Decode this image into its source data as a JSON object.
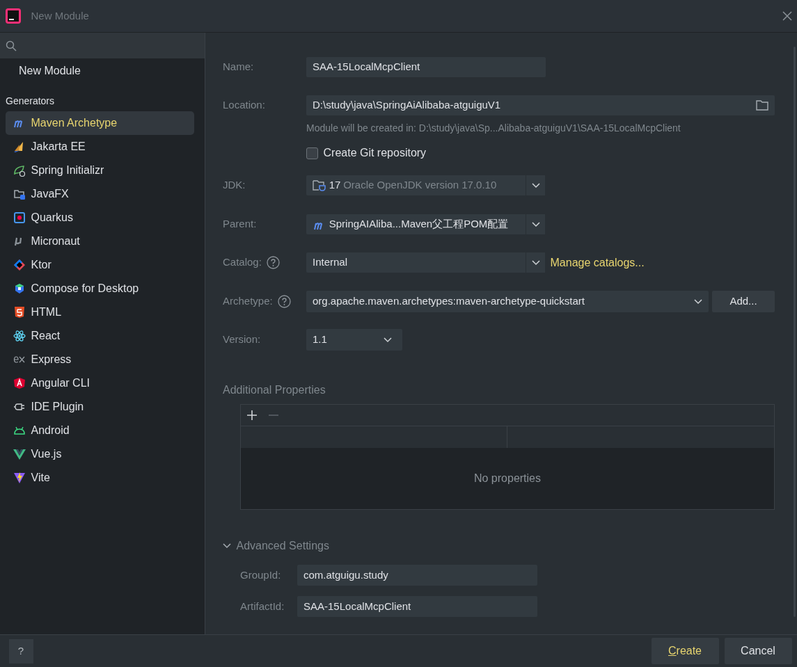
{
  "window": {
    "title": "New Module"
  },
  "sidebar": {
    "top_item": {
      "label": "New Module",
      "selected": false
    },
    "section": "Generators",
    "items": [
      {
        "label": "Maven Archetype",
        "selected": true
      },
      {
        "label": "Jakarta EE",
        "selected": false
      },
      {
        "label": "Spring Initializr",
        "selected": false
      },
      {
        "label": "JavaFX",
        "selected": false
      },
      {
        "label": "Quarkus",
        "selected": false
      },
      {
        "label": "Micronaut",
        "selected": false
      },
      {
        "label": "Ktor",
        "selected": false
      },
      {
        "label": "Compose for Desktop",
        "selected": false
      },
      {
        "label": "HTML",
        "selected": false
      },
      {
        "label": "React",
        "selected": false
      },
      {
        "label": "Express",
        "selected": false
      },
      {
        "label": "Angular CLI",
        "selected": false
      },
      {
        "label": "IDE Plugin",
        "selected": false
      },
      {
        "label": "Android",
        "selected": false
      },
      {
        "label": "Vue.js",
        "selected": false
      },
      {
        "label": "Vite",
        "selected": false
      }
    ]
  },
  "form": {
    "name": {
      "label": "Name:",
      "value": "SAA-15LocalMcpClient"
    },
    "location": {
      "label": "Location:",
      "value": "D:\\study\\java\\SpringAiAlibaba-atguiguV1",
      "note": "Module will be created in: D:\\study\\java\\Sp...Alibaba-atguiguV1\\SAA-15LocalMcpClient"
    },
    "git": {
      "label": "Create Git repository",
      "checked": false
    },
    "jdk": {
      "label": "JDK:",
      "version": "17",
      "text": "Oracle OpenJDK version 17.0.10"
    },
    "parent": {
      "label": "Parent:",
      "value": "SpringAIAliba...Maven父工程POM配置"
    },
    "catalog": {
      "label": "Catalog:",
      "help": true,
      "value": "Internal",
      "link": "Manage catalogs..."
    },
    "archetype": {
      "label": "Archetype:",
      "help": true,
      "value": "org.apache.maven.archetypes:maven-archetype-quickstart",
      "button": "Add..."
    },
    "version": {
      "label": "Version:",
      "value": "1.1"
    },
    "additional_properties": {
      "title": "Additional Properties",
      "empty_text": "No properties"
    },
    "advanced": {
      "title": "Advanced Settings",
      "expanded": true,
      "fields": [
        {
          "label": "GroupId:",
          "value": "com.atguigu.study"
        },
        {
          "label": "ArtifactId:",
          "value": "SAA-15LocalMcpClient"
        }
      ]
    }
  },
  "footer": {
    "help": "?",
    "buttons": [
      {
        "label": "Create",
        "kind": "primary"
      },
      {
        "label": "Cancel",
        "kind": "secondary"
      }
    ]
  }
}
